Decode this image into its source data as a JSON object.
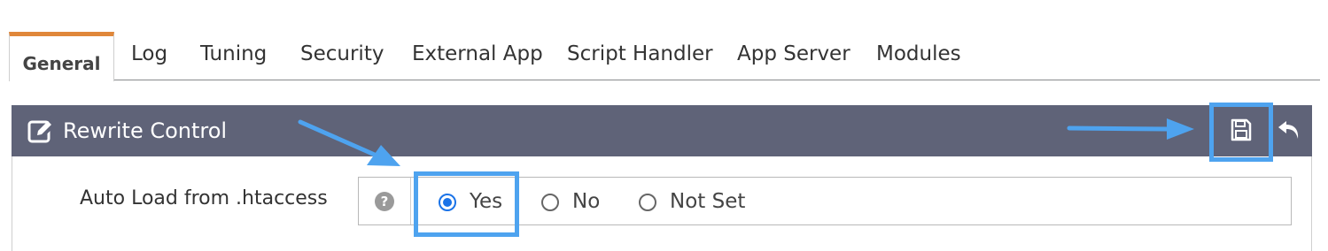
{
  "tabs": [
    {
      "label": "General",
      "active": true
    },
    {
      "label": "Log"
    },
    {
      "label": "Tuning"
    },
    {
      "label": "Security"
    },
    {
      "label": "External App"
    },
    {
      "label": "Script Handler"
    },
    {
      "label": "App Server"
    },
    {
      "label": "Modules"
    }
  ],
  "panel": {
    "title": "Rewrite Control",
    "title_icon": "edit-icon",
    "actions": [
      {
        "name": "save",
        "icon": "save-icon"
      },
      {
        "name": "undo",
        "icon": "undo-icon"
      }
    ]
  },
  "field": {
    "label": "Auto Load from .htaccess",
    "help_icon": "question-circle-icon",
    "options": [
      {
        "label": "Yes",
        "checked": true
      },
      {
        "label": "No",
        "checked": false
      },
      {
        "label": "Not Set",
        "checked": false
      }
    ]
  },
  "colors": {
    "accent_tab": "#e0873a",
    "panel_header": "#5f6378",
    "radio_checked": "#1a73e8",
    "annotation": "#4ea3ef"
  }
}
